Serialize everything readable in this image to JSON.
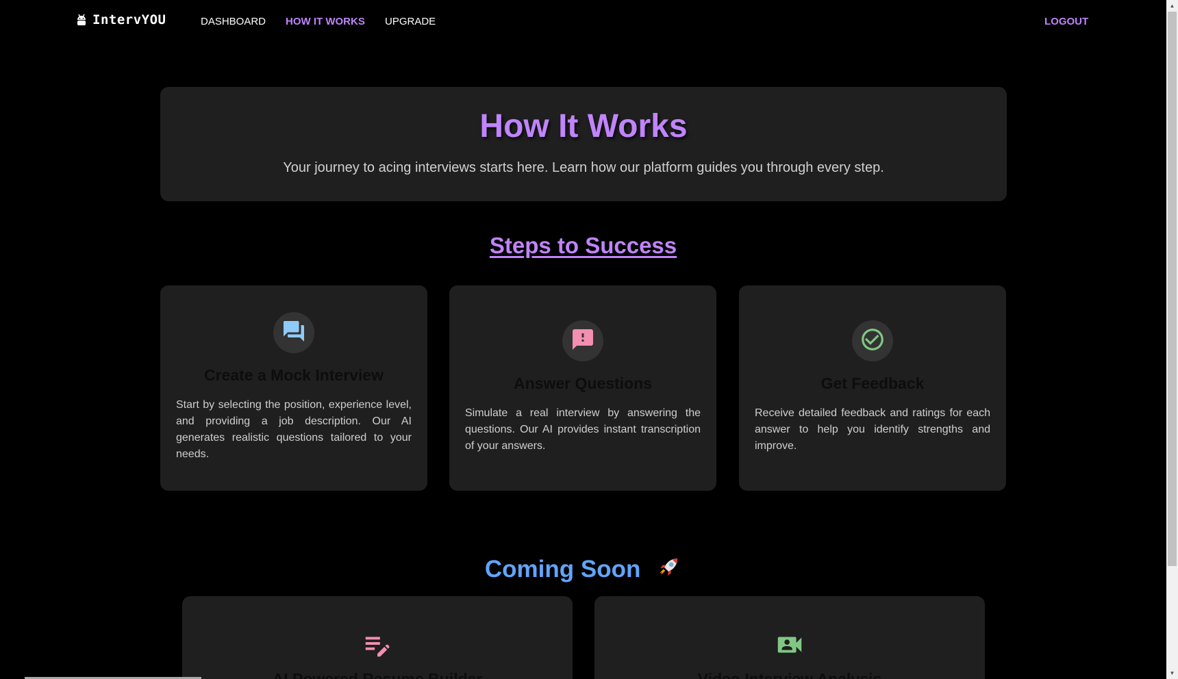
{
  "nav": {
    "brand": "IntervYOU",
    "links": [
      "DASHBOARD",
      "HOW IT WORKS",
      "UPGRADE"
    ],
    "active": "HOW IT WORKS",
    "logout": "LOGOUT"
  },
  "hero": {
    "title": "How It Works",
    "subtitle": "Your journey to acing interviews starts here. Learn how our platform guides you through every step."
  },
  "steps": {
    "heading": "Steps to Success",
    "items": [
      {
        "icon": "chat-bubbles-icon",
        "title": "Create a Mock Interview",
        "description": "Start by selecting the position, experience level, and providing a job description. Our AI generates realistic questions tailored to your needs."
      },
      {
        "icon": "feedback-message-icon",
        "title": "Answer Questions",
        "description": "Simulate a real interview by answering the questions. Our AI provides instant transcription of your answers."
      },
      {
        "icon": "check-circle-icon",
        "title": "Get Feedback",
        "description": "Receive detailed feedback and ratings for each answer to help you identify strengths and improve."
      }
    ]
  },
  "coming_soon": {
    "heading": "Coming Soon",
    "items": [
      {
        "icon": "edit-note-icon",
        "title": "AI Powered Resume Builder"
      },
      {
        "icon": "video-camera-icon",
        "title": "Video Interview Analysis"
      }
    ]
  },
  "colors": {
    "accent_purple": "#c084fc",
    "accent_blue": "#60a5fa",
    "step1_icon": "#90caf9",
    "step2_icon": "#f48fb1",
    "step3_icon": "#81c784",
    "card_bg": "#1f1f1f",
    "page_bg": "#000000"
  }
}
